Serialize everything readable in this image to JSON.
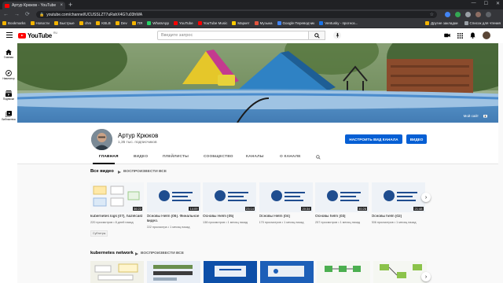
{
  "browser": {
    "tab_title": "Артур Крюков - YouTube",
    "new_tab": "+",
    "close": "×",
    "url": "youtube.com/channel/UCUSSLZT7uRahX4G7u03hWA",
    "window_controls": [
      "—",
      "☐",
      "✕"
    ],
    "nav": [
      "←",
      "→",
      "⟳"
    ],
    "bookmarks": [
      {
        "label": "Bookmarks",
        "color": "#f4b400"
      },
      {
        "label": "Новости",
        "color": "#f4b400"
      },
      {
        "label": "Быстрые",
        "color": "#f4b400"
      },
      {
        "label": "chm",
        "color": "#f4b400"
      },
      {
        "label": "KBLB",
        "color": "#f4b400"
      },
      {
        "label": "Dev",
        "color": "#f4b400"
      },
      {
        "label": "ПЯ",
        "color": "#f4b400"
      },
      {
        "label": "WhatsApp",
        "color": "#25d366"
      },
      {
        "label": "YouTube",
        "color": "#ff0000"
      },
      {
        "label": "YouTube Music",
        "color": "#ff0000"
      },
      {
        "label": "Маркет",
        "color": "#ffcc00"
      },
      {
        "label": "Музыка",
        "color": "#e2543e"
      },
      {
        "label": "Google Переводчик",
        "color": "#4285f4"
      },
      {
        "label": "Ventusky - прогноз...",
        "color": "#1a73e8"
      }
    ],
    "bookmarks_right": [
      "Другие закладки",
      "Список для чтения"
    ]
  },
  "yt_header": {
    "logo_text": "YouTube",
    "logo_region": "RU",
    "search_placeholder": "Введите запрос"
  },
  "sidebar": {
    "items": [
      {
        "label": "Главная",
        "icon": "home-icon"
      },
      {
        "label": "Навигатор",
        "icon": "explore-icon"
      },
      {
        "label": "Подписки",
        "icon": "subscriptions-icon"
      },
      {
        "label": "Библиотека",
        "icon": "library-icon"
      }
    ]
  },
  "banner": {
    "links": [
      "Мой сайт"
    ]
  },
  "channel": {
    "name": "Артур Крюков",
    "subscribers": "1,35 тыс. подписчиков",
    "customize_label": "НАСТРОИТЬ ВИД КАНАЛА",
    "video_label": "ВИДЕО"
  },
  "tabs": [
    {
      "label": "ГЛАВНАЯ",
      "active": true
    },
    {
      "label": "ВИДЕО",
      "active": false
    },
    {
      "label": "ПЛЕЙЛИСТЫ",
      "active": false
    },
    {
      "label": "СООБЩЕСТВО",
      "active": false
    },
    {
      "label": "КАНАЛЫ",
      "active": false
    },
    {
      "label": "О КАНАЛЕ",
      "active": false
    }
  ],
  "shelves": [
    {
      "title": "Все видео",
      "play_all": "ВОСПРОИЗВЕСТИ ВСЕ",
      "videos": [
        {
          "title": "kubernetes logs [07], hazelcast",
          "duration": "36:22",
          "meta": "220 просмотров • 8 дней назад",
          "badge": "Субтитры"
        },
        {
          "title": "Основы Helm [06]. Финальное видео.",
          "duration": "14:09",
          "meta": "222 просмотра • 1 месяц назад",
          "badge": ""
        },
        {
          "title": "Основы Helm [05]",
          "duration": "23:14",
          "meta": "138 просмотров • 1 месяц назад",
          "badge": ""
        },
        {
          "title": "Основы Helm [04]",
          "duration": "20:34",
          "meta": "170 просмотров • 1 месяц назад",
          "badge": ""
        },
        {
          "title": "Основы helm [03]",
          "duration": "30:26",
          "meta": "257 просмотров • 1 месяц назад",
          "badge": ""
        },
        {
          "title": "Основы helm [02]",
          "duration": "21:48",
          "meta": "306 просмотров • 1 месяц назад",
          "badge": ""
        }
      ]
    },
    {
      "title": "kubernetes network",
      "play_all": "ВОСПРОИЗВЕСТИ ВСЕ"
    }
  ],
  "colors": {
    "accent": "#065fd4",
    "yt_red": "#ff0000",
    "page_bg": "#f9f9f9"
  }
}
